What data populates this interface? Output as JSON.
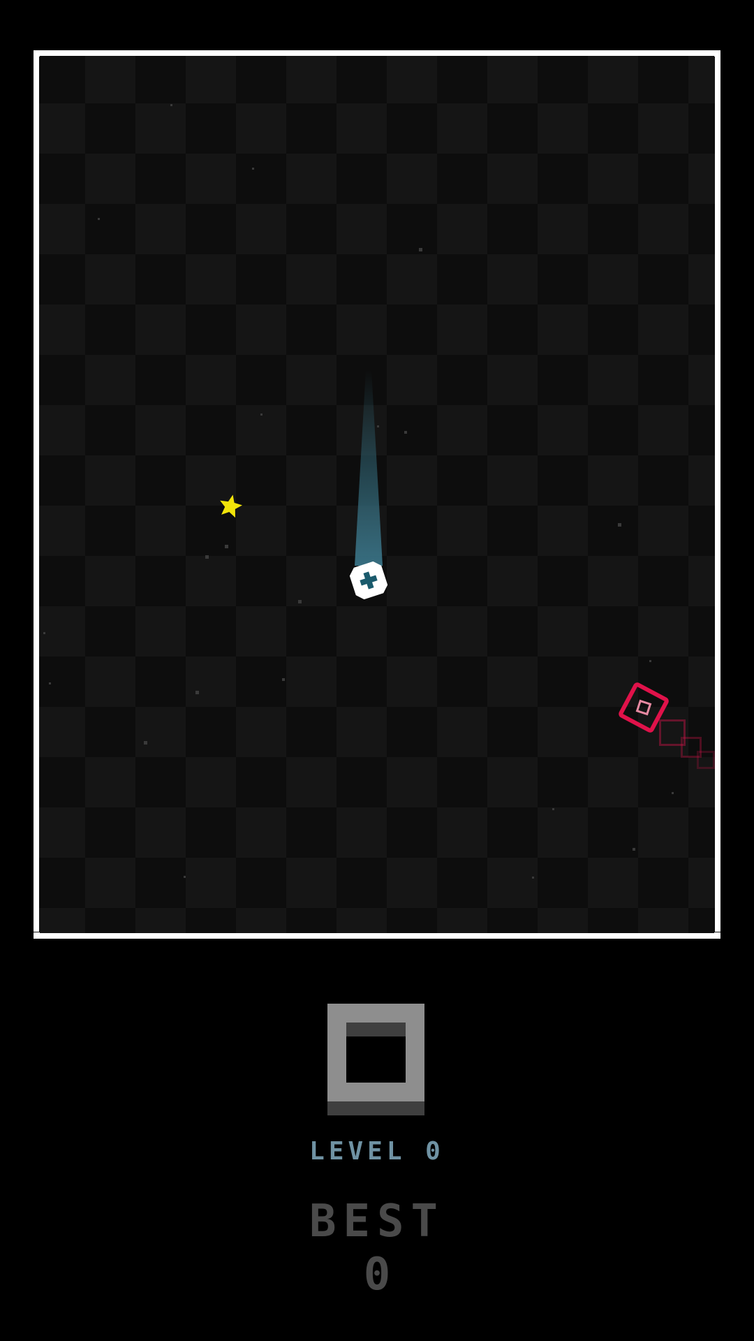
{
  "hud": {
    "score": "0",
    "level_text": "LEVEL 0",
    "best_label": "BEST",
    "best_value": "0"
  },
  "colors": {
    "background": "#000000",
    "frame": "#ffffff",
    "player": "#ffffff",
    "player_mark": "#1a5a6c",
    "trail": "#3c788c",
    "pickup": "#f2e40a",
    "enemy": "#e0124a",
    "score_digit": "#8e8e8e",
    "level_text": "#6f92a3",
    "best_text": "#4a4a4a"
  },
  "entities": {
    "player_icon": "cross-ship-icon",
    "pickup_icon": "star-icon",
    "enemy_icon": "diamond-enemy-icon"
  }
}
